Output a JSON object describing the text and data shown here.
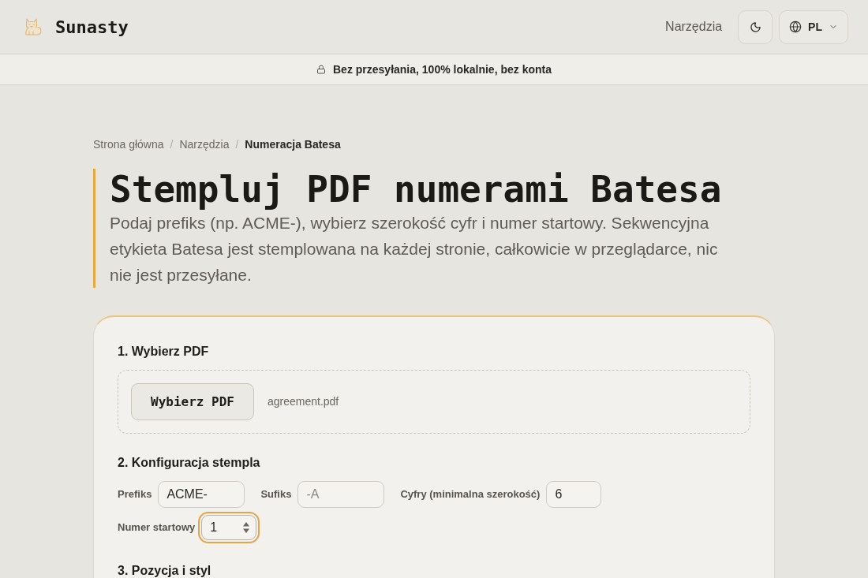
{
  "header": {
    "brand": "Sunasty",
    "nav_link": "Narzędzia",
    "language": "PL"
  },
  "banner": {
    "text": "Bez przesyłania, 100% lokalnie, bez konta"
  },
  "breadcrumb": {
    "separator": "/",
    "items": [
      {
        "label": "Strona główna",
        "current": false
      },
      {
        "label": "Narzędzia",
        "current": false
      },
      {
        "label": "Numeracja Batesa",
        "current": true
      }
    ]
  },
  "hero": {
    "title": "Stempluj PDF numerami Batesa",
    "description": "Podaj prefiks (np. ACME-), wybierz szerokość cyfr i numer startowy. Sekwencyjna etykieta Batesa jest stemplowana na każdej stronie, całkowicie w przeglądarce, nic nie jest przesyłane."
  },
  "sections": [
    {
      "kind": "file",
      "heading": "1. Wybierz PDF",
      "button": "Wybierz PDF",
      "file_name": "agreement.pdf"
    },
    {
      "kind": "fields",
      "heading": "2. Konfiguracja stempla",
      "fields": [
        {
          "label": "Prefiks",
          "kind": "text",
          "value": "ACME-",
          "focused": false
        },
        {
          "label": "Sufiks",
          "kind": "text",
          "placeholder": "-A",
          "focused": false
        },
        {
          "label": "Cyfry (minimalna szerokość)",
          "kind": "number",
          "value": "6",
          "focused": false
        },
        {
          "label": "Numer startowy",
          "kind": "number",
          "value": "1",
          "focused": true
        }
      ]
    },
    {
      "kind": "heading",
      "heading": "3. Pozycja i styl"
    }
  ]
}
